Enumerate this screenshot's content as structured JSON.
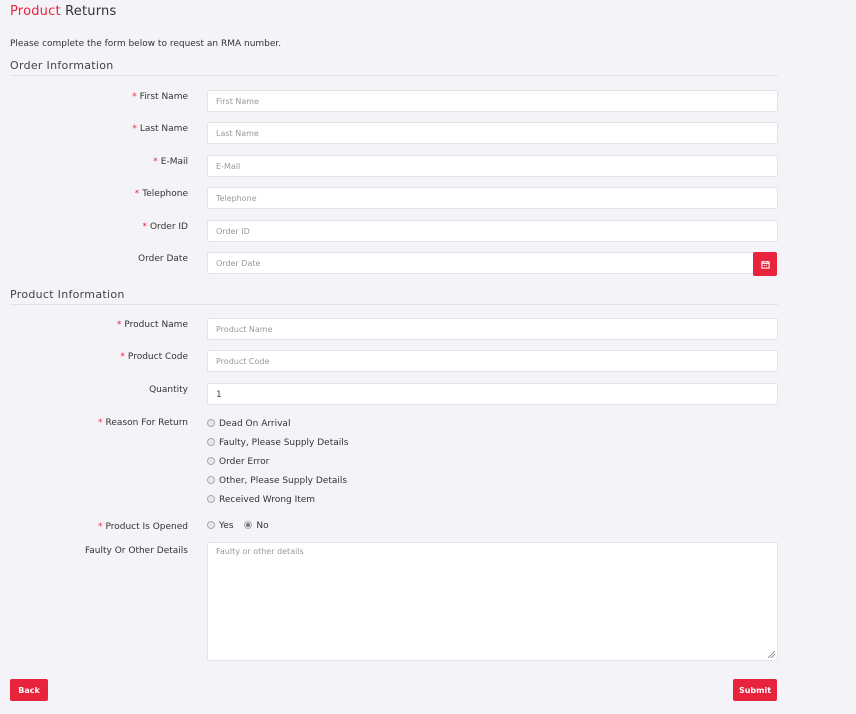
{
  "title": {
    "accent": "Product",
    "rest": "Returns"
  },
  "intro": "Please complete the form below to request an RMA number.",
  "sections": {
    "order": "Order Information",
    "product": "Product Information"
  },
  "order_fields": {
    "first_name": {
      "label": "First Name",
      "placeholder": "First Name",
      "required": true
    },
    "last_name": {
      "label": "Last Name",
      "placeholder": "Last Name",
      "required": true
    },
    "email": {
      "label": "E-Mail",
      "placeholder": "E-Mail",
      "required": true
    },
    "telephone": {
      "label": "Telephone",
      "placeholder": "Telephone",
      "required": true
    },
    "order_id": {
      "label": "Order ID",
      "placeholder": "Order ID",
      "required": true
    },
    "order_date": {
      "label": "Order Date",
      "placeholder": "Order Date",
      "required": false
    }
  },
  "product_fields": {
    "product_name": {
      "label": "Product Name",
      "placeholder": "Product Name",
      "required": true
    },
    "product_code": {
      "label": "Product Code",
      "placeholder": "Product Code",
      "required": true
    },
    "quantity": {
      "label": "Quantity",
      "value": "1",
      "required": false
    }
  },
  "reason": {
    "label": "Reason For Return",
    "options": [
      "Dead On Arrival",
      "Faulty, Please Supply Details",
      "Order Error",
      "Other, Please Supply Details",
      "Received Wrong Item"
    ]
  },
  "opened": {
    "label": "Product Is Opened",
    "yes": "Yes",
    "no": "No",
    "selected": "No"
  },
  "details": {
    "label": "Faulty Or Other Details",
    "placeholder": "Faulty or other details"
  },
  "buttons": {
    "back": "Back",
    "submit": "Submit"
  },
  "icons": {
    "calendar": "calendar-icon"
  },
  "colors": {
    "accent": "#e8233c",
    "background": "#f4f4f8"
  },
  "required_mark": "*"
}
